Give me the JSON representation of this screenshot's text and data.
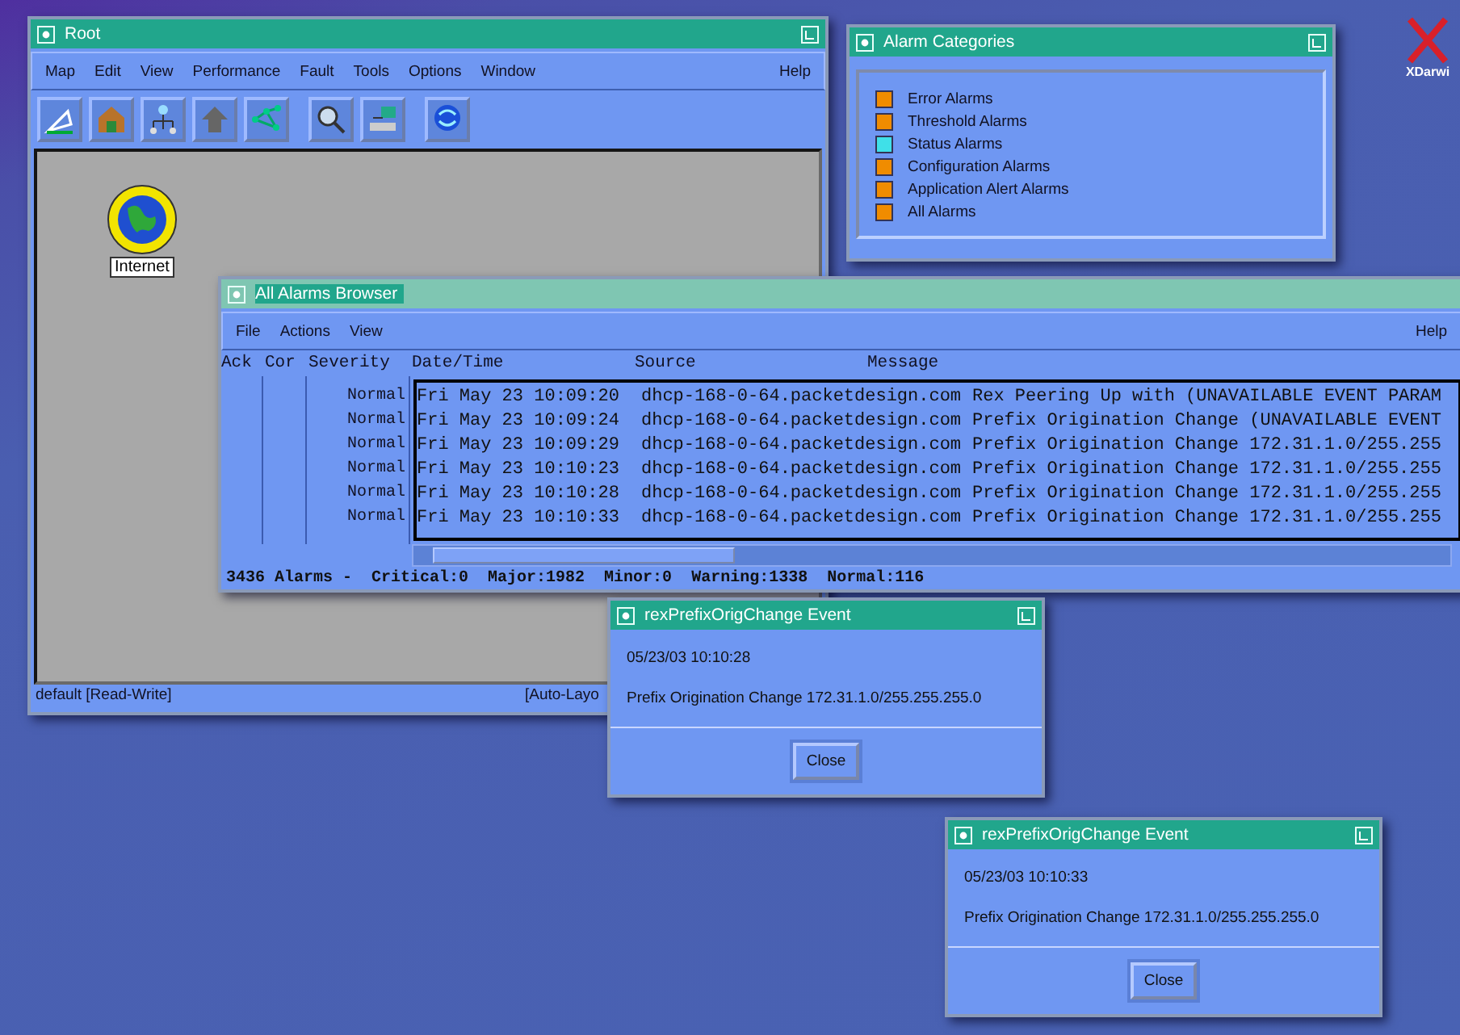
{
  "root_window": {
    "title": "Root",
    "menu": [
      "Map",
      "Edit",
      "View",
      "Performance",
      "Fault",
      "Tools",
      "Options",
      "Window"
    ],
    "help": "Help",
    "node_label": "Internet",
    "status_left": "default [Read-Write]",
    "status_right": "[Auto-Layo"
  },
  "alarm_categories": {
    "title": "Alarm Categories",
    "items": [
      {
        "label": "Error Alarms",
        "color": "#f08c00"
      },
      {
        "label": "Threshold Alarms",
        "color": "#f08c00"
      },
      {
        "label": "Status Alarms",
        "color": "#3fe0e8"
      },
      {
        "label": "Configuration Alarms",
        "color": "#f08c00"
      },
      {
        "label": "Application Alert Alarms",
        "color": "#f08c00"
      },
      {
        "label": "All Alarms",
        "color": "#f08c00"
      }
    ]
  },
  "desktop_icon": {
    "label": "XDarwi"
  },
  "alarms_browser": {
    "title": "All Alarms Browser",
    "menu": [
      "File",
      "Actions",
      "View"
    ],
    "help": "Help",
    "columns": [
      "Ack",
      "Cor",
      "Severity",
      "Date/Time",
      "Source",
      "Message"
    ],
    "rows": [
      {
        "severity": "Normal",
        "date_time": "Fri May 23 10:09:20",
        "source": "dhcp-168-0-64.packetdesign.com",
        "message": "Rex Peering Up with (UNAVAILABLE EVENT PARAM"
      },
      {
        "severity": "Normal",
        "date_time": "Fri May 23 10:09:24",
        "source": "dhcp-168-0-64.packetdesign.com",
        "message": "Prefix Origination Change (UNAVAILABLE EVENT"
      },
      {
        "severity": "Normal",
        "date_time": "Fri May 23 10:09:29",
        "source": "dhcp-168-0-64.packetdesign.com",
        "message": "Prefix Origination Change 172.31.1.0/255.255"
      },
      {
        "severity": "Normal",
        "date_time": "Fri May 23 10:10:23",
        "source": "dhcp-168-0-64.packetdesign.com",
        "message": "Prefix Origination Change 172.31.1.0/255.255"
      },
      {
        "severity": "Normal",
        "date_time": "Fri May 23 10:10:28",
        "source": "dhcp-168-0-64.packetdesign.com",
        "message": "Prefix Origination Change 172.31.1.0/255.255"
      },
      {
        "severity": "Normal",
        "date_time": "Fri May 23 10:10:33",
        "source": "dhcp-168-0-64.packetdesign.com",
        "message": "Prefix Origination Change 172.31.1.0/255.255"
      }
    ],
    "summary": [
      "3436 Alarms -",
      "Critical:0",
      "Major:1982",
      "Minor:0",
      "Warning:1338",
      "Normal:116"
    ]
  },
  "event_windows": [
    {
      "title": "rexPrefixOrigChange Event",
      "timestamp": "05/23/03 10:10:28",
      "message": "Prefix Origination Change 172.31.1.0/255.255.255.0",
      "button": "Close"
    },
    {
      "title": "rexPrefixOrigChange Event",
      "timestamp": "05/23/03 10:10:33",
      "message": "Prefix Origination Change 172.31.1.0/255.255.255.0",
      "button": "Close"
    }
  ]
}
